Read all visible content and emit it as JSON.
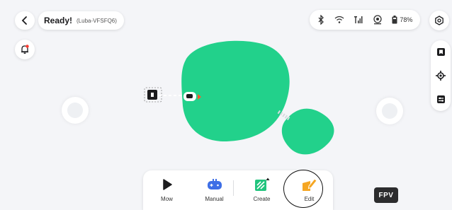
{
  "header": {
    "back_icon": "chevron-left-icon",
    "status_main": "Ready!",
    "status_sub": "(Luba-VFSFQ6)",
    "battery_percent": "78%",
    "icons": [
      "bluetooth-icon",
      "wifi-icon",
      "cellular-signal-icon",
      "gps-icon",
      "battery-icon"
    ],
    "settings_icon": "settings-icon"
  },
  "left_tools": {
    "bell_icon": "notification-bell-icon"
  },
  "right_tools": {
    "icons": [
      "map-bookmark-icon",
      "locate-icon",
      "task-settings-icon"
    ]
  },
  "map": {
    "zone_color": "#22d18b",
    "elements": [
      "zone-large",
      "zone-small",
      "channel-path",
      "charging-station",
      "mower-robot"
    ]
  },
  "actions": [
    {
      "label": "Mow",
      "icon": "play-icon"
    },
    {
      "label": "Manual",
      "icon": "gamepad-icon"
    },
    {
      "label": "Create",
      "icon": "create-zone-icon"
    },
    {
      "label": "Edit",
      "icon": "edit-zone-icon"
    }
  ],
  "fpv": {
    "label": "FPV"
  },
  "colors": {
    "accent": "#22d18b",
    "edit_orange": "#f5a623",
    "manual_blue": "#3d6ee6",
    "alert_red": "#ff3b30"
  }
}
